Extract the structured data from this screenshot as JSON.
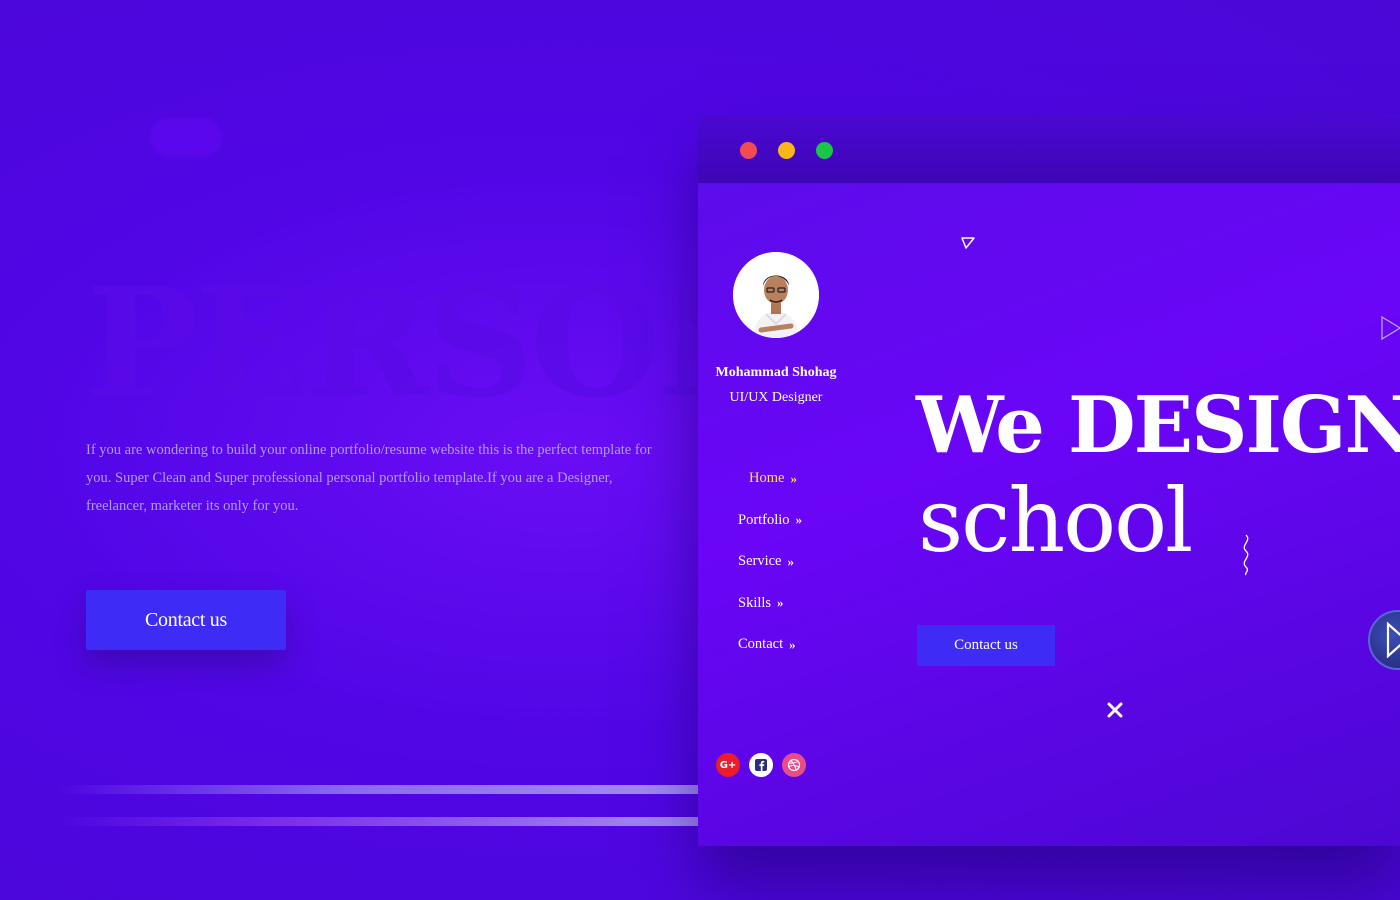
{
  "background": {
    "big_title": "PERSON",
    "intro_text": "If you are wondering to build your online portfolio/resume website this is the perfect template for you. Super Clean and Super professional personal portfolio template.If you are a Designer, freelancer, marketer its only for you.",
    "contact_button": "Contact us"
  },
  "preview": {
    "profile": {
      "name": "Mohammad Shohag",
      "role": "UI/UX Designer"
    },
    "nav": [
      {
        "label": "Home",
        "active": true
      },
      {
        "label": "Portfolio",
        "active": false
      },
      {
        "label": "Service",
        "active": false
      },
      {
        "label": "Skills",
        "active": false
      },
      {
        "label": "Contact",
        "active": false
      }
    ],
    "chevron": "»",
    "socials": [
      "google-plus-icon",
      "facebook-icon",
      "dribbble-icon"
    ],
    "hero_line1": "We DESIGN",
    "hero_line2": "school",
    "contact_button": "Contact us"
  },
  "colors": {
    "background": "#5106e6",
    "button": "#3e2bf6",
    "active_nav": "#ffe04a",
    "dot_red": "#f24b54",
    "dot_yellow": "#f8b617",
    "dot_green": "#1bc546"
  }
}
